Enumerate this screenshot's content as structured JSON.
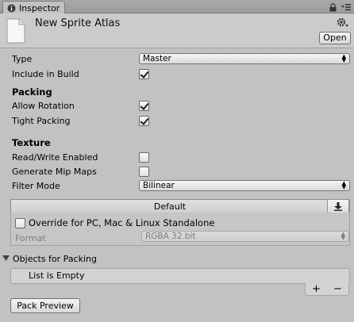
{
  "tab": {
    "title": "Inspector"
  },
  "header": {
    "asset_name": "New Sprite Atlas",
    "open_label": "Open"
  },
  "fields": {
    "type_label": "Type",
    "type_value": "Master",
    "include_label": "Include in Build",
    "include_checked": true
  },
  "packing": {
    "title": "Packing",
    "allow_rotation_label": "Allow Rotation",
    "allow_rotation_checked": true,
    "tight_packing_label": "Tight Packing",
    "tight_packing_checked": true
  },
  "texture": {
    "title": "Texture",
    "readwrite_label": "Read/Write Enabled",
    "readwrite_checked": false,
    "mipmaps_label": "Generate Mip Maps",
    "mipmaps_checked": false,
    "filter_label": "Filter Mode",
    "filter_value": "Bilinear"
  },
  "platform": {
    "default_label": "Default",
    "override_label": "Override for PC, Mac & Linux Standalone",
    "override_checked": false,
    "format_label": "Format",
    "format_value": "RGBA 32 bit"
  },
  "objects": {
    "title": "Objects for Packing",
    "empty_text": "List is Empty",
    "add_label": "+",
    "remove_label": "−"
  },
  "pack_preview_label": "Pack Preview"
}
